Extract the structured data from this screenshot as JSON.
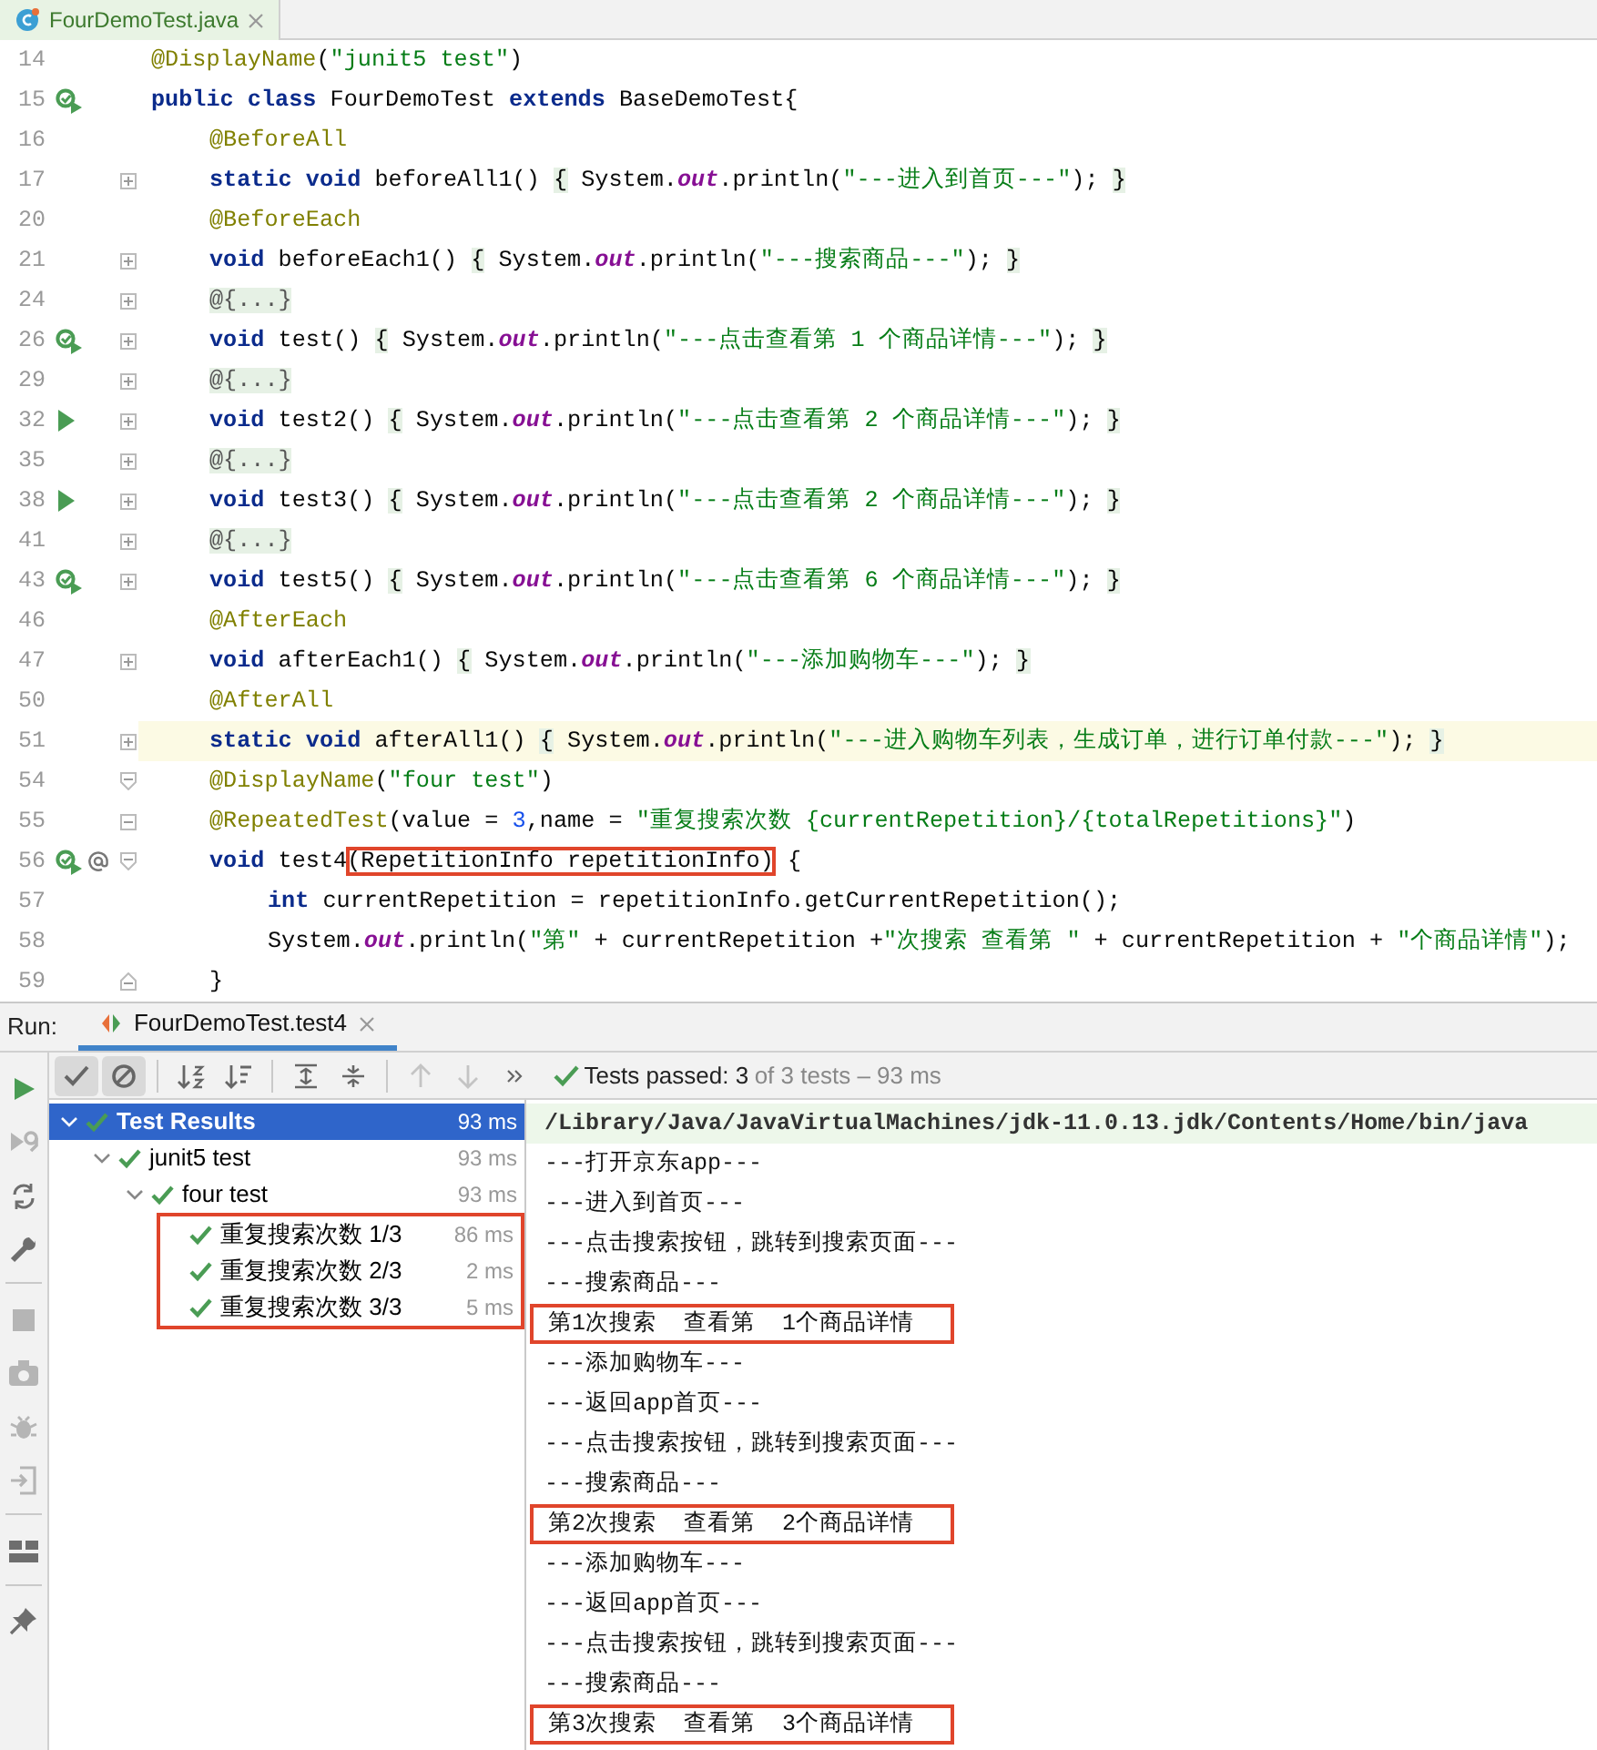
{
  "editor": {
    "tab": {
      "label": "FourDemoTest.java",
      "selected": true
    },
    "lines": [
      {
        "number": "14",
        "current": false,
        "tokens": [
          {
            "kind": "ann",
            "text": "@DisplayName"
          },
          {
            "kind": "plain",
            "text": "("
          },
          {
            "kind": "str",
            "text": "\"junit5 test\""
          },
          {
            "kind": "plain",
            "text": ")"
          }
        ]
      },
      {
        "number": "15",
        "gutter_icons": [
          {
            "kind": "rerun"
          }
        ],
        "current": false,
        "tokens": [
          {
            "kind": "kw",
            "text": "public class"
          },
          {
            "kind": "plain",
            "text": " FourDemoTest "
          },
          {
            "kind": "kw",
            "text": "extends"
          },
          {
            "kind": "plain",
            "text": " BaseDemoTest{"
          }
        ],
        "children": [
          {
            "number": "16",
            "current": false,
            "tokens": [
              {
                "kind": "ann",
                "text": "@BeforeAll"
              }
            ]
          },
          {
            "number": "17",
            "fold": {
              "kind": "expand"
            },
            "current": false,
            "tokens": [
              {
                "kind": "kw",
                "text": "static void"
              },
              {
                "kind": "plain",
                "text": " beforeAll1() "
              },
              {
                "kind": "brace",
                "text": "{"
              },
              {
                "kind": "plain",
                "text": " System."
              },
              {
                "kind": "field",
                "text": "out"
              },
              {
                "kind": "plain",
                "text": ".println("
              },
              {
                "kind": "str",
                "text": "\"---进入到首页---\""
              },
              {
                "kind": "plain",
                "text": "); "
              },
              {
                "kind": "brace",
                "text": "}"
              }
            ]
          },
          {
            "number": "20",
            "current": false,
            "tokens": [
              {
                "kind": "ann",
                "text": "@BeforeEach"
              }
            ]
          },
          {
            "number": "21",
            "fold": {
              "kind": "expand"
            },
            "current": false,
            "tokens": [
              {
                "kind": "kw",
                "text": "void"
              },
              {
                "kind": "plain",
                "text": " beforeEach1() "
              },
              {
                "kind": "brace",
                "text": "{"
              },
              {
                "kind": "plain",
                "text": " System."
              },
              {
                "kind": "field",
                "text": "out"
              },
              {
                "kind": "plain",
                "text": ".println("
              },
              {
                "kind": "str",
                "text": "\"---搜索商品---\""
              },
              {
                "kind": "plain",
                "text": "); "
              },
              {
                "kind": "brace",
                "text": "}"
              }
            ]
          },
          {
            "number": "24",
            "fold": {
              "kind": "expand"
            },
            "current": false,
            "tokens": [
              {
                "kind": "folded",
                "text": "@{...}"
              }
            ]
          },
          {
            "number": "26",
            "gutter_icons": [
              {
                "kind": "rerun"
              }
            ],
            "fold": {
              "kind": "expand"
            },
            "current": false,
            "tokens": [
              {
                "kind": "kw",
                "text": "void"
              },
              {
                "kind": "plain",
                "text": " test() "
              },
              {
                "kind": "brace",
                "text": "{"
              },
              {
                "kind": "plain",
                "text": " System."
              },
              {
                "kind": "field",
                "text": "out"
              },
              {
                "kind": "plain",
                "text": ".println("
              },
              {
                "kind": "str",
                "text": "\"---点击查看第 1 个商品详情---\""
              },
              {
                "kind": "plain",
                "text": "); "
              },
              {
                "kind": "brace",
                "text": "}"
              }
            ]
          },
          {
            "number": "29",
            "fold": {
              "kind": "expand"
            },
            "current": false,
            "tokens": [
              {
                "kind": "folded",
                "text": "@{...}"
              }
            ]
          },
          {
            "number": "32",
            "gutter_icons": [
              {
                "kind": "run"
              }
            ],
            "fold": {
              "kind": "expand"
            },
            "current": false,
            "tokens": [
              {
                "kind": "kw",
                "text": "void"
              },
              {
                "kind": "plain",
                "text": " test2() "
              },
              {
                "kind": "brace",
                "text": "{"
              },
              {
                "kind": "plain",
                "text": " System."
              },
              {
                "kind": "field",
                "text": "out"
              },
              {
                "kind": "plain",
                "text": ".println("
              },
              {
                "kind": "str",
                "text": "\"---点击查看第 2 个商品详情---\""
              },
              {
                "kind": "plain",
                "text": "); "
              },
              {
                "kind": "brace",
                "text": "}"
              }
            ]
          },
          {
            "number": "35",
            "fold": {
              "kind": "expand"
            },
            "current": false,
            "tokens": [
              {
                "kind": "folded",
                "text": "@{...}"
              }
            ]
          },
          {
            "number": "38",
            "gutter_icons": [
              {
                "kind": "run"
              }
            ],
            "fold": {
              "kind": "expand"
            },
            "current": false,
            "tokens": [
              {
                "kind": "kw",
                "text": "void"
              },
              {
                "kind": "plain",
                "text": " test3() "
              },
              {
                "kind": "brace",
                "text": "{"
              },
              {
                "kind": "plain",
                "text": " System."
              },
              {
                "kind": "field",
                "text": "out"
              },
              {
                "kind": "plain",
                "text": ".println("
              },
              {
                "kind": "str",
                "text": "\"---点击查看第 2 个商品详情---\""
              },
              {
                "kind": "plain",
                "text": "); "
              },
              {
                "kind": "brace",
                "text": "}"
              }
            ]
          },
          {
            "number": "41",
            "fold": {
              "kind": "expand"
            },
            "current": false,
            "tokens": [
              {
                "kind": "folded",
                "text": "@{...}"
              }
            ]
          },
          {
            "number": "43",
            "gutter_icons": [
              {
                "kind": "rerun"
              }
            ],
            "fold": {
              "kind": "expand"
            },
            "current": false,
            "tokens": [
              {
                "kind": "kw",
                "text": "void"
              },
              {
                "kind": "plain",
                "text": " test5() "
              },
              {
                "kind": "brace",
                "text": "{"
              },
              {
                "kind": "plain",
                "text": " System."
              },
              {
                "kind": "field",
                "text": "out"
              },
              {
                "kind": "plain",
                "text": ".println("
              },
              {
                "kind": "str",
                "text": "\"---点击查看第 6 个商品详情---\""
              },
              {
                "kind": "plain",
                "text": "); "
              },
              {
                "kind": "brace",
                "text": "}"
              }
            ]
          },
          {
            "number": "46",
            "current": false,
            "tokens": [
              {
                "kind": "ann",
                "text": "@AfterEach"
              }
            ]
          },
          {
            "number": "47",
            "fold": {
              "kind": "expand"
            },
            "current": false,
            "tokens": [
              {
                "kind": "kw",
                "text": "void"
              },
              {
                "kind": "plain",
                "text": " afterEach1() "
              },
              {
                "kind": "brace",
                "text": "{"
              },
              {
                "kind": "plain",
                "text": " System."
              },
              {
                "kind": "field",
                "text": "out"
              },
              {
                "kind": "plain",
                "text": ".println("
              },
              {
                "kind": "str",
                "text": "\"---添加购物车---\""
              },
              {
                "kind": "plain",
                "text": "); "
              },
              {
                "kind": "brace",
                "text": "}"
              }
            ]
          },
          {
            "number": "50",
            "current": false,
            "tokens": [
              {
                "kind": "ann",
                "text": "@AfterAll"
              }
            ]
          },
          {
            "number": "51",
            "fold": {
              "kind": "expand"
            },
            "current": true,
            "tokens": [
              {
                "kind": "kw",
                "text": "static void"
              },
              {
                "kind": "plain",
                "text": " afterAll1() "
              },
              {
                "kind": "brace",
                "text": "{"
              },
              {
                "kind": "plain",
                "text": " System."
              },
              {
                "kind": "field",
                "text": "out"
              },
              {
                "kind": "plain",
                "text": ".println("
              },
              {
                "kind": "str",
                "text": "\"---进入购物车列表，生成订单，进行订单付款---\""
              },
              {
                "kind": "plain",
                "text": "); "
              },
              {
                "kind": "brace",
                "text": "}"
              }
            ]
          },
          {
            "number": "54",
            "fold": {
              "kind": "start"
            },
            "current": false,
            "tokens": [
              {
                "kind": "ann",
                "text": "@DisplayName"
              },
              {
                "kind": "plain",
                "text": "("
              },
              {
                "kind": "str",
                "text": "\"four test\""
              },
              {
                "kind": "plain",
                "text": ")"
              }
            ]
          },
          {
            "number": "55",
            "fold": {
              "kind": "collapse"
            },
            "current": false,
            "tokens": [
              {
                "kind": "ann",
                "text": "@RepeatedTest"
              },
              {
                "kind": "plain",
                "text": "(value = "
              },
              {
                "kind": "num",
                "text": "3"
              },
              {
                "kind": "plain",
                "text": ",name = "
              },
              {
                "kind": "str",
                "text": "\"重复搜索次数 {currentRepetition}/{totalRepetitions}\""
              },
              {
                "kind": "plain",
                "text": ")"
              }
            ]
          },
          {
            "number": "56",
            "gutter_icons": [
              {
                "kind": "rerun"
              },
              {
                "kind": "at"
              }
            ],
            "fold": {
              "kind": "start"
            },
            "current": false,
            "tokens": [
              {
                "kind": "kw",
                "text": "void"
              },
              {
                "kind": "plain",
                "text": " test4"
              },
              {
                "kind": "plain",
                "text": "(RepetitionInfo repetitionInfo)",
                "outlined": true
              },
              {
                "kind": "plain",
                "text": " {"
              }
            ],
            "children": [
              {
                "number": "57",
                "current": false,
                "tokens": [
                  {
                    "kind": "kw",
                    "text": "int"
                  },
                  {
                    "kind": "plain",
                    "text": " currentRepetition = repetitionInfo.getCurrentRepetition();"
                  }
                ]
              },
              {
                "number": "58",
                "current": false,
                "tokens": [
                  {
                    "kind": "plain",
                    "text": "System."
                  },
                  {
                    "kind": "field",
                    "text": "out"
                  },
                  {
                    "kind": "plain",
                    "text": ".println("
                  },
                  {
                    "kind": "str",
                    "text": "\"第\""
                  },
                  {
                    "kind": "plain",
                    "text": " + currentRepetition +"
                  },
                  {
                    "kind": "str",
                    "text": "\"次搜索 查看第 \""
                  },
                  {
                    "kind": "plain",
                    "text": " + currentRepetition + "
                  },
                  {
                    "kind": "str",
                    "text": "\"个商品详情\""
                  },
                  {
                    "kind": "plain",
                    "text": ");"
                  }
                ]
              }
            ]
          },
          {
            "number": "59",
            "fold": {
              "kind": "end"
            },
            "current": false,
            "tokens": [
              {
                "kind": "plain",
                "text": "}"
              }
            ]
          }
        ]
      }
    ]
  },
  "run_panel": {
    "label": "Run:",
    "tabs": [
      {
        "label": "FourDemoTest.test4",
        "selected": true
      }
    ],
    "side_tools": [
      {
        "kind": "run",
        "disabled": false
      },
      {
        "kind": "rerun_failed",
        "disabled": true
      },
      {
        "kind": "toggle_auto",
        "disabled": false
      },
      {
        "kind": "settings",
        "disabled": false
      },
      {
        "kind": "separator"
      },
      {
        "kind": "stop",
        "disabled": true
      },
      {
        "kind": "camera",
        "disabled": true
      },
      {
        "kind": "bug",
        "disabled": true
      },
      {
        "kind": "exit",
        "disabled": true
      },
      {
        "kind": "separator"
      },
      {
        "kind": "layout",
        "disabled": false
      },
      {
        "kind": "separator"
      },
      {
        "kind": "pin",
        "disabled": false
      }
    ],
    "toolbar": [
      {
        "kind": "show_passed",
        "pressed": true,
        "disabled": false
      },
      {
        "kind": "show_ignored",
        "pressed": true,
        "disabled": false
      },
      {
        "kind": "separator"
      },
      {
        "kind": "sort_alpha",
        "pressed": false,
        "disabled": false
      },
      {
        "kind": "sort_duration",
        "pressed": false,
        "disabled": false
      },
      {
        "kind": "separator"
      },
      {
        "kind": "expand_all",
        "pressed": false,
        "disabled": false
      },
      {
        "kind": "collapse_all",
        "pressed": false,
        "disabled": false
      },
      {
        "kind": "separator"
      },
      {
        "kind": "previous",
        "pressed": false,
        "disabled": true
      },
      {
        "kind": "next",
        "pressed": false,
        "disabled": true
      },
      {
        "kind": "more",
        "pressed": false,
        "disabled": false
      }
    ],
    "status": {
      "passed": true,
      "summary": "Tests passed: 3",
      "detail": "of 3 tests – 93 ms"
    },
    "tree": {
      "label": "Test Results",
      "time": "93 ms",
      "passed": true,
      "expanded": true,
      "selected": true,
      "children_outlined": false,
      "children": [
        {
          "label": "junit5 test",
          "time": "93 ms",
          "passed": true,
          "expanded": true,
          "selected": false,
          "children_outlined": false,
          "children": [
            {
              "label": "four test",
              "time": "93 ms",
              "passed": true,
              "expanded": true,
              "selected": false,
              "children_outlined": true,
              "children": [
                {
                  "label": "重复搜索次数 1/3",
                  "time": "86 ms",
                  "passed": true,
                  "selected": false
                },
                {
                  "label": "重复搜索次数 2/3",
                  "time": "2 ms",
                  "passed": true,
                  "selected": false
                },
                {
                  "label": "重复搜索次数 3/3",
                  "time": "5 ms",
                  "passed": true,
                  "selected": false
                }
              ]
            }
          ]
        }
      ]
    },
    "console": [
      {
        "kind": "command",
        "text": "/Library/Java/JavaVirtualMachines/jdk-11.0.13.jdk/Contents/Home/bin/java",
        "outlined": false
      },
      {
        "kind": "output",
        "text": "---打开京东app---",
        "outlined": false
      },
      {
        "kind": "output",
        "text": "---进入到首页---",
        "outlined": false
      },
      {
        "kind": "output",
        "text": "---点击搜索按钮，跳转到搜索页面---",
        "outlined": false
      },
      {
        "kind": "output",
        "text": "---搜索商品---",
        "outlined": false
      },
      {
        "kind": "output",
        "text": "第1次搜索  查看第  1个商品详情",
        "outlined": true
      },
      {
        "kind": "output",
        "text": "---添加购物车---",
        "outlined": false
      },
      {
        "kind": "output",
        "text": "---返回app首页---",
        "outlined": false
      },
      {
        "kind": "output",
        "text": "---点击搜索按钮，跳转到搜索页面---",
        "outlined": false
      },
      {
        "kind": "output",
        "text": "---搜索商品---",
        "outlined": false
      },
      {
        "kind": "output",
        "text": "第2次搜索  查看第  2个商品详情",
        "outlined": true
      },
      {
        "kind": "output",
        "text": "---添加购物车---",
        "outlined": false
      },
      {
        "kind": "output",
        "text": "---返回app首页---",
        "outlined": false
      },
      {
        "kind": "output",
        "text": "---点击搜索按钮，跳转到搜索页面---",
        "outlined": false
      },
      {
        "kind": "output",
        "text": "---搜索商品---",
        "outlined": false
      },
      {
        "kind": "output",
        "text": "第3次搜索  查看第  3个商品详情",
        "outlined": true
      }
    ]
  }
}
